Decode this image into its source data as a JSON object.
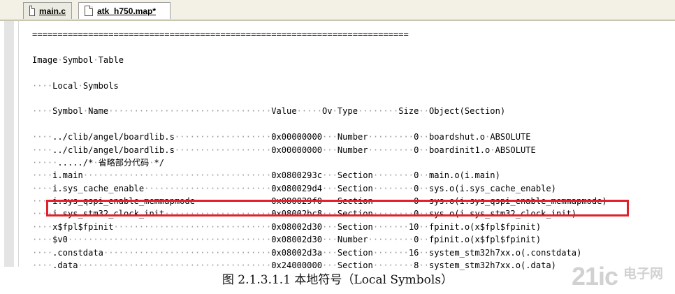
{
  "tabs": [
    {
      "label": "main.c",
      "active": false
    },
    {
      "label": "atk_h750.map*",
      "active": true
    }
  ],
  "editor": {
    "lines": [
      "==========================================================================",
      "",
      "Image·Symbol·Table",
      "",
      "····Local·Symbols",
      "",
      "····Symbol·Name································Value·····Ov·Type········Size··Object(Section)",
      "",
      "····../clib/angel/boardlib.s···················0x00000000···Number·········0··boardshut.o·ABSOLUTE",
      "····../clib/angel/boardlib.s···················0x00000000···Number·········0··boardinit1.o·ABSOLUTE",
      "·····...../*·省略部分代码·*/",
      "····i.main·····································0x0800293c···Section········0··main.o(i.main)",
      "····i.sys_cache_enable·························0x080029d4···Section········0··sys.o(i.sys_cache_enable)",
      "····i.sys_qspi_enable_memmapmode···············0x080029f0···Section········0··sys.o(i.sys_qspi_enable_memmapmode)",
      "····i.sys_stm32_clock_init·····················0x08002bc8···Section········0··sys.o(i.sys_stm32_clock_init)",
      "····x$fpl$fpinit·······························0x08002d30···Section·······10··fpinit.o(x$fpl$fpinit)",
      "····$v0········································0x08002d30···Number·········0··fpinit.o(x$fpl$fpinit)",
      "····.constdata·································0x08002d3a···Section·······16··system_stm32h7xx.o(.constdata)",
      "····.data······································0x24000000···Section········8··system_stm32h7xx.o(.data)"
    ]
  },
  "highlight_color": "#e0202a",
  "caption": "图 2.1.3.1.1  本地符号（Local Symbols）",
  "watermark": {
    "big": "21ic",
    "small": "电子网"
  }
}
